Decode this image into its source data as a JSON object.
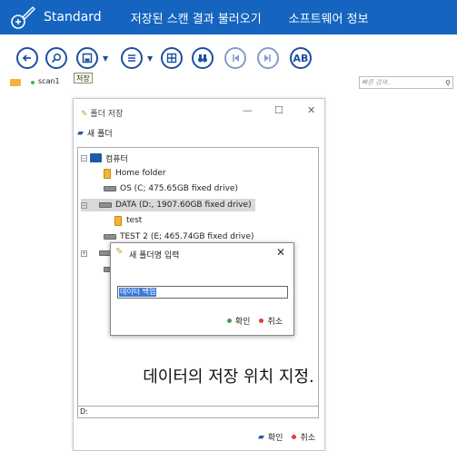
{
  "menubar": {
    "app_name": "Standard",
    "items": [
      "저장된 스캔 결과 불러오기",
      "소프트웨어 정보"
    ]
  },
  "toolbar": {
    "tooltip": "저장",
    "ab_label": "AB"
  },
  "location": {
    "text": "scan1",
    "quick_search_placeholder": "빠른 검색.."
  },
  "folder_dialog": {
    "title": "폴더 저장",
    "new_folder": "새 폴더",
    "tree": {
      "computer": "컴퓨터",
      "home": "Home folder",
      "os": "OS (C; 475.65GB fixed drive)",
      "data": "DATA (D:, 1907.60GB fixed drive)",
      "test": "test",
      "test2": "TEST 2 (E; 465.74GB fixed drive)"
    },
    "path": "D:",
    "ok": "확인",
    "cancel": "취소"
  },
  "new_folder_dialog": {
    "title": "새 폴더명 입력",
    "value": "데이터 백업",
    "ok": "확인",
    "cancel": "취소"
  },
  "caption": "데이터의 저장 위치 지정.",
  "colors": {
    "menubar": "#1565c0",
    "accent": "#1e4fa0",
    "selection": "#3b79d6"
  }
}
